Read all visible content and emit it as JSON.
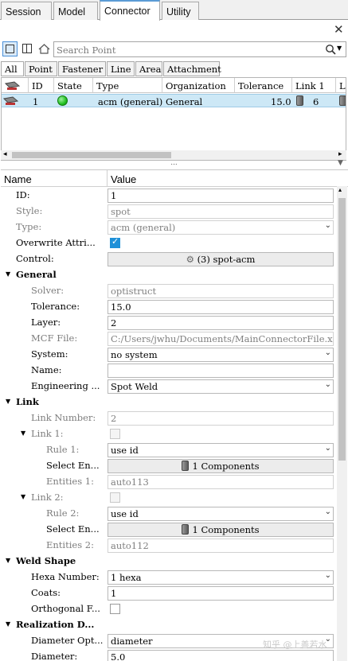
{
  "tabs": [
    "Session",
    "Model",
    "Connector",
    "Utility"
  ],
  "search": {
    "placeholder": "Search Point"
  },
  "filters": [
    "All",
    "Point",
    "Fastener",
    "Line",
    "Area",
    "Attachment"
  ],
  "grid": {
    "headers": [
      "ID",
      "State",
      "Type",
      "Organization",
      "Tolerance",
      "Link 1",
      "L:"
    ],
    "row": {
      "id": "1",
      "type": "acm (general)",
      "organization": "General",
      "tolerance": "15.0",
      "link1": "6"
    }
  },
  "splitter": "...",
  "props": {
    "name_header": "Name",
    "value_header": "Value",
    "rows": [
      {
        "label": "ID:",
        "value": "1"
      },
      {
        "label": "Style:",
        "value": "spot"
      },
      {
        "label": "Type:",
        "value": "acm (general)"
      },
      {
        "label": "Overwrite Attri..."
      },
      {
        "label": "Control:",
        "value": "(3) spot-acm"
      },
      {
        "label": "General"
      },
      {
        "label": "Solver:",
        "value": "optistruct"
      },
      {
        "label": "Tolerance:",
        "value": "15.0"
      },
      {
        "label": "Layer:",
        "value": "2"
      },
      {
        "label": "MCF File:",
        "value": "C:/Users/jwhu/Documents/MainConnectorFile.xml"
      },
      {
        "label": "System:",
        "value": "no system"
      },
      {
        "label": "Name:",
        "value": ""
      },
      {
        "label": "Engineering ...",
        "value": "Spot Weld"
      },
      {
        "label": "Link"
      },
      {
        "label": "Link Number:",
        "value": "2"
      },
      {
        "label": "Link 1:"
      },
      {
        "label": "Rule 1:",
        "value": "use id"
      },
      {
        "label": "Select En...",
        "value": "1 Components"
      },
      {
        "label": "Entities 1:",
        "value": "auto113"
      },
      {
        "label": "Link 2:"
      },
      {
        "label": "Rule 2:",
        "value": "use id"
      },
      {
        "label": "Select En...",
        "value": "1 Components"
      },
      {
        "label": "Entities 2:",
        "value": "auto112"
      },
      {
        "label": "Weld Shape"
      },
      {
        "label": "Hexa Number:",
        "value": "1 hexa"
      },
      {
        "label": "Coats:",
        "value": "1"
      },
      {
        "label": "Orthogonal F..."
      },
      {
        "label": "Realization D..."
      },
      {
        "label": "Diameter Opt...",
        "value": "diameter"
      },
      {
        "label": "Diameter:",
        "value": "5.0"
      }
    ]
  },
  "watermark": "知乎 @上善若水",
  "colors": {
    "selected_row": "#cde8f6",
    "check_blue": "#1e90d8",
    "state_green": "#22c022"
  }
}
